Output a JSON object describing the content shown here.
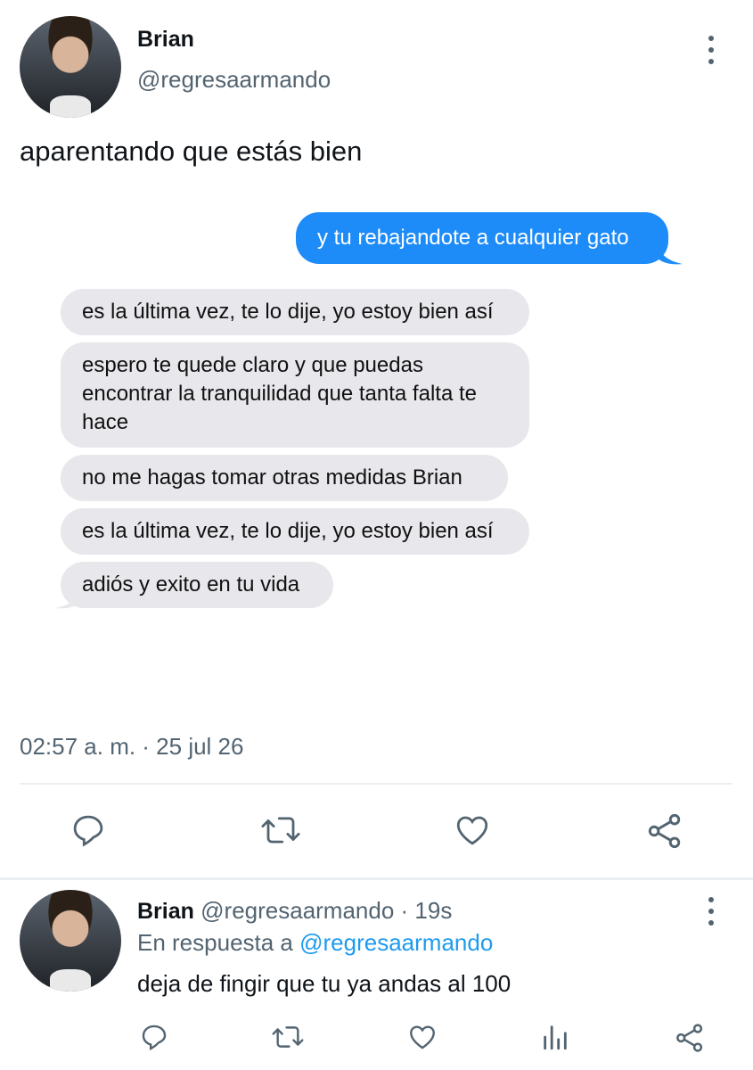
{
  "main_tweet": {
    "author_name": "Brian",
    "author_handle": "@regresaarmando",
    "text": "aparentando que estás bien",
    "timestamp": "02:57 a. m. · 25 jul 26"
  },
  "chat": {
    "sent": "y tu rebajandote a cualquier gato",
    "received": [
      "es la última vez, te lo dije, yo estoy bien así",
      "espero te quede claro y que puedas encontrar la tranquilidad que tanta falta te hace",
      "no me hagas tomar otras medidas Brian",
      "es la última vez, te lo dije, yo estoy bien así",
      "adiós y exito en tu vida"
    ]
  },
  "actions": [
    "reply-icon",
    "retweet-icon",
    "like-icon",
    "share-icon"
  ],
  "reply_tweet": {
    "author_name": "Brian",
    "author_handle": "@regresaarmando",
    "time": "· 19s",
    "reply_prefix": "En respuesta a",
    "reply_to": "@regresaarmando",
    "text": "deja de fingir que tu ya andas al 100",
    "actions": [
      "reply-icon",
      "retweet-icon",
      "like-icon",
      "analytics-icon",
      "share-icon"
    ]
  },
  "colors": {
    "accent": "#1d9bf0",
    "sent_bubble": "#1d8cf8",
    "received_bubble": "#e7e7ec",
    "muted": "#536471"
  }
}
